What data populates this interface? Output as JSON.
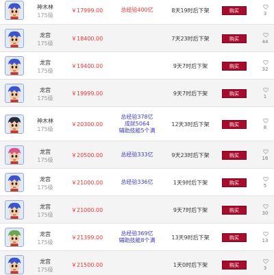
{
  "buy_label": "购买",
  "colors": {
    "price": "#e33333",
    "info_blue": "#3a3ac8",
    "buy_button": "#a80c2c"
  },
  "listings": [
    {
      "server": "神木林",
      "level": "175级",
      "price": "￥17999.00",
      "info": [
        "总经验400亿"
      ],
      "info_style": "red",
      "time": "8天19时后下架",
      "favorites": "3",
      "avatar": "blue-hair"
    },
    {
      "server": "龙宫",
      "level": "175级",
      "price": "￥18400.00",
      "info": [],
      "info_style": "none",
      "time": "7天23时后下架",
      "favorites": "44",
      "avatar": "blue-hair"
    },
    {
      "server": "龙宫",
      "level": "175级",
      "price": "￥19400.00",
      "info": [],
      "info_style": "none",
      "time": "9天7时后下架",
      "favorites": "32",
      "avatar": "blue-hair"
    },
    {
      "server": "龙宫",
      "level": "175级",
      "price": "￥19999.00",
      "info": [],
      "info_style": "none",
      "time": "9天7时后下架",
      "favorites": "1",
      "avatar": "blue-hair"
    },
    {
      "server": "神木林",
      "level": "175级",
      "price": "￥20300.00",
      "info": [
        "总经验378亿",
        "成就5064",
        "辅助技能5个满"
      ],
      "info_style": "blue",
      "time": "12天3时后下架",
      "favorites": "8",
      "avatar": "dark-hair"
    },
    {
      "server": "龙宫",
      "level": "175级",
      "price": "￥20500.00",
      "info": [
        "总经验333亿"
      ],
      "info_style": "blue",
      "time": "9天23时后下架",
      "favorites": "16",
      "avatar": "pink-hair"
    },
    {
      "server": "龙宫",
      "level": "175级",
      "price": "￥21000.00",
      "info": [
        "总经验336亿"
      ],
      "info_style": "blue",
      "time": "1天9时后下架",
      "favorites": "5",
      "avatar": "blue-hair"
    },
    {
      "server": "龙宫",
      "level": "175级",
      "price": "￥21000.00",
      "info": [],
      "info_style": "none",
      "time": "9天7时后下架",
      "favorites": "30",
      "avatar": "blue-hair"
    },
    {
      "server": "龙宫",
      "level": "175级",
      "price": "￥21399.00",
      "info": [
        "总经验369亿",
        "辅助技能8个满"
      ],
      "info_style": "blue",
      "time": "13天9时后下架",
      "favorites": "13",
      "avatar": "green-hair"
    },
    {
      "server": "龙宫",
      "level": "175级",
      "price": "￥21500.00",
      "info": [],
      "info_style": "none",
      "time": "1天0时后下架",
      "favorites": "3",
      "avatar": "blue-hair"
    }
  ]
}
